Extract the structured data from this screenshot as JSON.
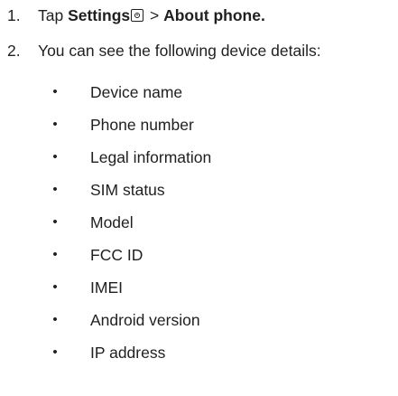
{
  "steps": [
    {
      "number": "1.",
      "prefix": "Tap ",
      "settings": "Settings",
      "settings_icon": "settings-gear-icon",
      "separator": " > ",
      "about": "About phone."
    },
    {
      "number": "2.",
      "text": "You can see the following device details:"
    }
  ],
  "bullet_symbol": "•",
  "details": [
    "Device name",
    "Phone number",
    "Legal information",
    "SIM status",
    "Model",
    "FCC ID",
    "IMEI",
    "Android version",
    "IP address"
  ]
}
